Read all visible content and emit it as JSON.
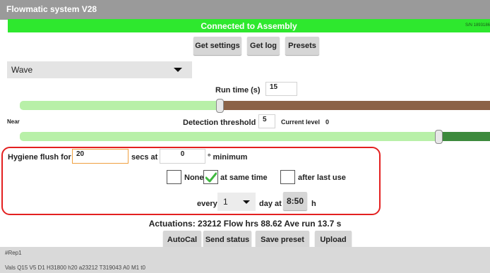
{
  "app": {
    "title": "Flowmatic system V28"
  },
  "status": {
    "text": "Connected to Assembly",
    "serial": "S/N 1893186"
  },
  "toolbar": {
    "get_settings": "Get settings",
    "get_log": "Get log",
    "presets": "Presets"
  },
  "mode": {
    "selected": "Wave"
  },
  "run_time": {
    "label": "Run time (s)",
    "value": "15",
    "slider_fraction": 0.51
  },
  "detection": {
    "near_label": "Near",
    "label": "Detection threshold",
    "value": "5",
    "current_level_label": "Current level",
    "current_level": "0",
    "slider_fraction": 0.91
  },
  "hygiene": {
    "label": "Hygiene flush for",
    "seconds": "20",
    "secs_at_label": "secs at",
    "minimum_value": "0",
    "minimum_label": "° minimum",
    "none_label": "None",
    "none_checked": false,
    "same_time_label": "at same time",
    "same_time_checked": true,
    "after_last_use_label": "after last use",
    "after_last_use_checked": false,
    "every_label": "every",
    "every_value": "1",
    "day_at_label": "day at",
    "time": "8:50",
    "h_label": "h"
  },
  "stats": {
    "text": "Actuations: 23212  Flow hrs 88.62 Ave run 13.7 s"
  },
  "actions": {
    "autocal": "AutoCal",
    "send_status": "Send status",
    "save_preset": "Save preset",
    "upload": "Upload"
  },
  "footer": {
    "rep": "#Rep1",
    "vals": "Vals Q15 V5 D1 H31800 h20 a23212 T319043 A0 M1 t0"
  },
  "colors": {
    "status_green": "#2ee82e",
    "slider_light": "#b8f0a8",
    "slider_brown": "#8b6246",
    "slider_dark_green": "#3d8a3d",
    "highlight_border": "#e32020",
    "input_focus_border": "#f0a040"
  }
}
